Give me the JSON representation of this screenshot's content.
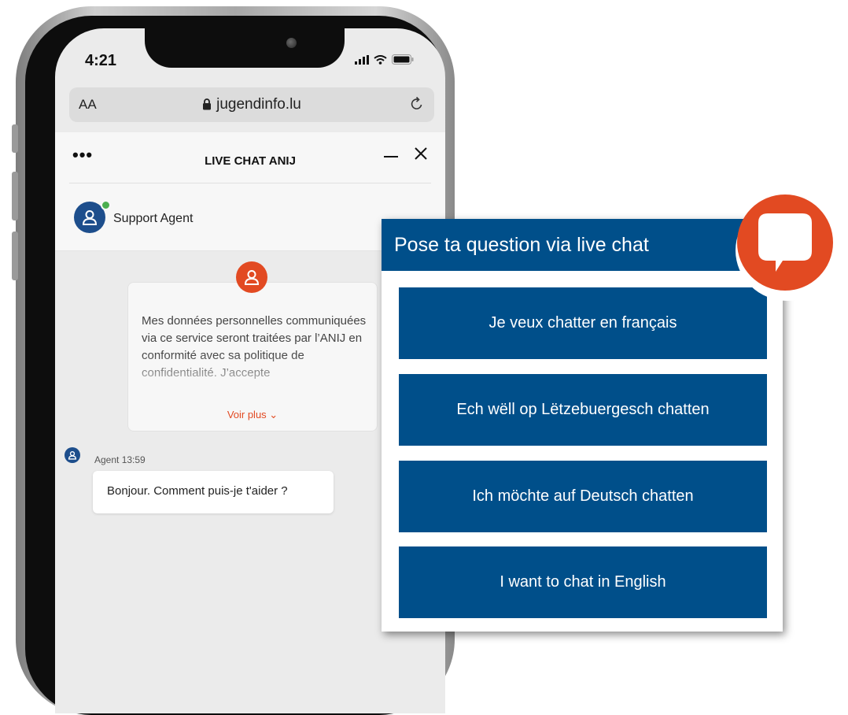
{
  "colors": {
    "brand_blue": "#004f8a",
    "accent_orange": "#e24a22",
    "agent_blue": "#1d4e8c",
    "online_green": "#4caf50"
  },
  "status_bar": {
    "time": "4:21",
    "icons": [
      "signal-icon",
      "wifi-icon",
      "battery-icon"
    ]
  },
  "browser": {
    "text_size_label": "AA",
    "host": "jugendinfo.lu",
    "icons": [
      "lock-icon",
      "reload-icon"
    ]
  },
  "chat": {
    "menu_label": "•••",
    "title": "LIVE CHAT ANIJ",
    "agent_name": "Support Agent",
    "consent_text": "Mes données personnelles communiquées via ce service seront traitées par l’ANIJ en conformité avec sa politique de confidentialité. J’accepte",
    "see_more_label": "Voir plus ⌄",
    "message": {
      "author": "Agent",
      "time": "13:59",
      "text": "Bonjour. Comment puis-je t'aider ?"
    }
  },
  "panel": {
    "title": "Pose ta question via live chat",
    "buttons": [
      {
        "label": "Je veux chatter en français"
      },
      {
        "label": "Ech wëll op Lëtzebuergesch chatten"
      },
      {
        "label": "Ich möchte auf Deutsch chatten"
      },
      {
        "label": "I want to chat in English"
      }
    ]
  }
}
